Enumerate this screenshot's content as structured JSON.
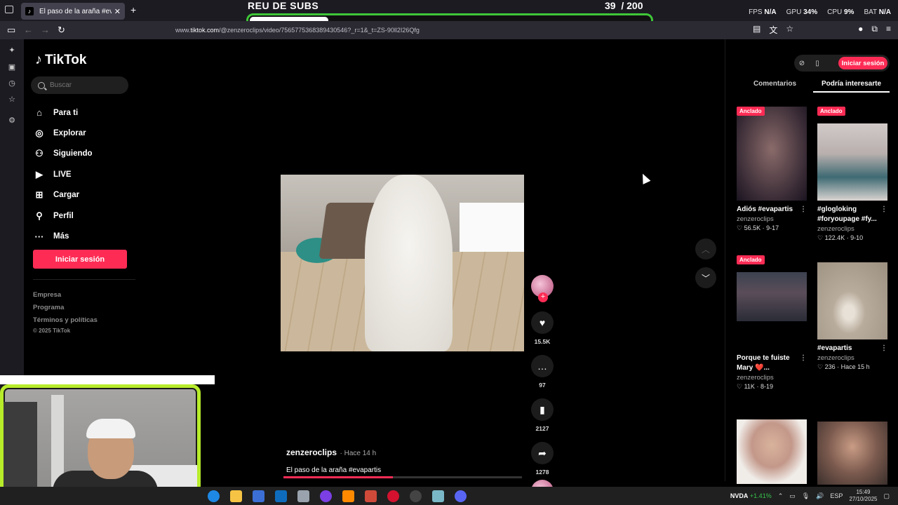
{
  "browser": {
    "tab_title": "El paso de la araña #evapa",
    "url_prefix": "www.",
    "url_host": "tiktok.com",
    "url_path": "/@zenzeroclips/video/7565775368389430546?_r=1&_t=ZS-90ll2I26Qfg"
  },
  "stream_overlay": {
    "goal_title": "REU DE SUBS",
    "goal_current": "39",
    "goal_separator": "/",
    "goal_total": "200",
    "goal_progress": 0.195,
    "accent_color": "#3fc738"
  },
  "perf": {
    "fps_label": "FPS",
    "fps_value": "N/A",
    "gpu_label": "GPU",
    "gpu_value": "34%",
    "cpu_label": "CPU",
    "cpu_value": "9%",
    "bat_label": "BAT",
    "bat_value": "N/A"
  },
  "tiktok": {
    "brand": "TikTok",
    "search_placeholder": "Buscar",
    "nav": [
      {
        "label": "Para ti",
        "icon": "home-icon"
      },
      {
        "label": "Explorar",
        "icon": "compass-icon"
      },
      {
        "label": "Siguiendo",
        "icon": "following-icon"
      },
      {
        "label": "LIVE",
        "icon": "live-icon"
      },
      {
        "label": "Cargar",
        "icon": "upload-icon"
      },
      {
        "label": "Perfil",
        "icon": "profile-icon"
      },
      {
        "label": "Más",
        "icon": "more-icon"
      }
    ],
    "login_button": "Iniciar sesión",
    "footer": {
      "company": "Empresa",
      "program": "Programa",
      "terms": "Términos y políticas",
      "copyright": "© 2025 TikTok"
    },
    "brand_color": "#fe2c55"
  },
  "video": {
    "username": "zenzeroclips",
    "time_ago": "· Hace 14 h",
    "caption": "El paso de la araña #evapartis",
    "progress": 0.46,
    "likes": "15.5K",
    "comments": "97",
    "saves": "2127",
    "shares": "1278"
  },
  "right_panel": {
    "login_button": "Iniciar sesión",
    "tabs": [
      "Comentarios",
      "Podría interesarte"
    ],
    "active_tab": 1,
    "pinned_label": "Anclado",
    "cards": [
      {
        "title": "Adiós #evapartis",
        "user": "zenzeroclips",
        "likes": "56.5K",
        "date": "9-17",
        "pinned": true
      },
      {
        "title": "#glogloking #foryoupage #fy...",
        "user": "zenzeroclips",
        "likes": "122.4K",
        "date": "9-10",
        "pinned": true
      },
      {
        "title": "Porque te fuiste Mary ❤️...",
        "user": "zenzeroclips",
        "likes": "11K",
        "date": "8-19",
        "pinned": true
      },
      {
        "title": "#evapartis",
        "user": "zenzeroclips",
        "likes": "236",
        "date": "Hace 15 h",
        "pinned": false
      }
    ]
  },
  "taskbar": {
    "stock_name": "NVDA",
    "stock_change": "+1.41%",
    "lang": "ESP",
    "time": "15:49",
    "date": "27/10/2025"
  }
}
